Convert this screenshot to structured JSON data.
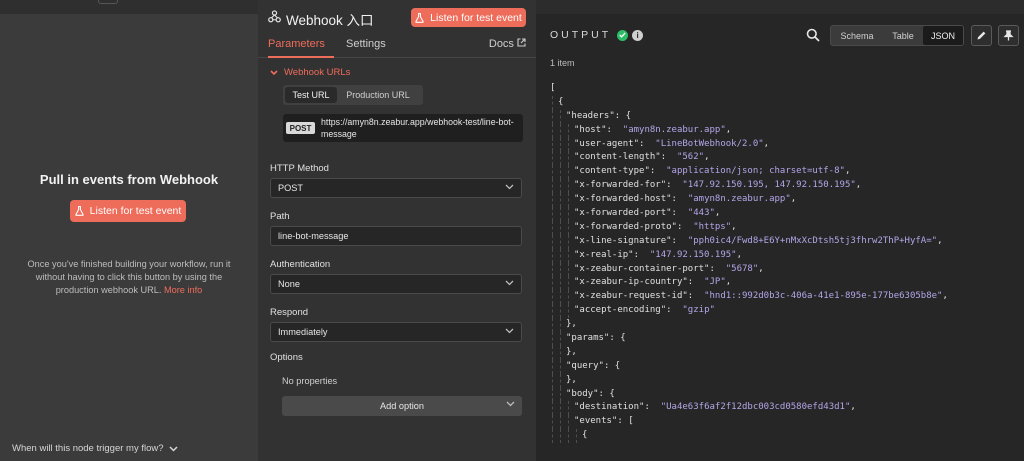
{
  "left_panel": {
    "title": "Pull in events from Webhook",
    "listen_button": "Listen for test event",
    "description": "Once you've finished building your workflow, run it without having to click this button by using the production webhook URL.",
    "more_info": "More info",
    "footer": "When will this node trigger my flow?"
  },
  "node": {
    "title": "Webhook 入口",
    "listen_button": "Listen for test event",
    "tabs": [
      "Parameters",
      "Settings"
    ],
    "docs": "Docs",
    "section": "Webhook URLs",
    "url_tabs": [
      "Test URL",
      "Production URL"
    ],
    "method_tag": "POST",
    "url": "https://amyn8n.zeabur.app/webhook-test/line-bot-message",
    "fields": {
      "http_method_label": "HTTP Method",
      "http_method_value": "POST",
      "path_label": "Path",
      "path_value": "line-bot-message",
      "auth_label": "Authentication",
      "auth_value": "None",
      "respond_label": "Respond",
      "respond_value": "Immediately",
      "options_label": "Options",
      "no_properties": "No properties",
      "add_option": "Add option"
    }
  },
  "output": {
    "title": "OUTPUT",
    "views": [
      "Schema",
      "Table",
      "JSON"
    ],
    "active_view": "JSON",
    "item_count": "1 item",
    "json_lines": [
      {
        "d": 0,
        "t": [
          [
            "p",
            "["
          ]
        ]
      },
      {
        "d": 1,
        "t": [
          [
            "p",
            "{"
          ]
        ]
      },
      {
        "d": 2,
        "t": [
          [
            "k",
            "\"headers\""
          ],
          [
            "p",
            ": {"
          ]
        ]
      },
      {
        "d": 3,
        "t": [
          [
            "k",
            "\"host\""
          ],
          [
            "p",
            ":  "
          ],
          [
            "s",
            "\"amyn8n.zeabur.app\""
          ],
          [
            "p",
            ","
          ]
        ]
      },
      {
        "d": 3,
        "t": [
          [
            "k",
            "\"user-agent\""
          ],
          [
            "p",
            ":  "
          ],
          [
            "s",
            "\"LineBotWebhook/2.0\""
          ],
          [
            "p",
            ","
          ]
        ]
      },
      {
        "d": 3,
        "t": [
          [
            "k",
            "\"content-length\""
          ],
          [
            "p",
            ":  "
          ],
          [
            "s",
            "\"562\""
          ],
          [
            "p",
            ","
          ]
        ]
      },
      {
        "d": 3,
        "t": [
          [
            "k",
            "\"content-type\""
          ],
          [
            "p",
            ":  "
          ],
          [
            "s",
            "\"application/json; charset=utf-8\""
          ],
          [
            "p",
            ","
          ]
        ]
      },
      {
        "d": 3,
        "t": [
          [
            "k",
            "\"x-forwarded-for\""
          ],
          [
            "p",
            ":  "
          ],
          [
            "s",
            "\"147.92.150.195, 147.92.150.195\""
          ],
          [
            "p",
            ","
          ]
        ]
      },
      {
        "d": 3,
        "t": [
          [
            "k",
            "\"x-forwarded-host\""
          ],
          [
            "p",
            ":  "
          ],
          [
            "s",
            "\"amyn8n.zeabur.app\""
          ],
          [
            "p",
            ","
          ]
        ]
      },
      {
        "d": 3,
        "t": [
          [
            "k",
            "\"x-forwarded-port\""
          ],
          [
            "p",
            ":  "
          ],
          [
            "s",
            "\"443\""
          ],
          [
            "p",
            ","
          ]
        ]
      },
      {
        "d": 3,
        "t": [
          [
            "k",
            "\"x-forwarded-proto\""
          ],
          [
            "p",
            ":  "
          ],
          [
            "s",
            "\"https\""
          ],
          [
            "p",
            ","
          ]
        ]
      },
      {
        "d": 3,
        "t": [
          [
            "k",
            "\"x-line-signature\""
          ],
          [
            "p",
            ":  "
          ],
          [
            "s",
            "\"pph0ic4/Fwd8+E6Y+nMxXcDtsh5tj3fhrw2ThP+HyfA=\""
          ],
          [
            "p",
            ","
          ]
        ]
      },
      {
        "d": 3,
        "t": [
          [
            "k",
            "\"x-real-ip\""
          ],
          [
            "p",
            ":  "
          ],
          [
            "s",
            "\"147.92.150.195\""
          ],
          [
            "p",
            ","
          ]
        ]
      },
      {
        "d": 3,
        "t": [
          [
            "k",
            "\"x-zeabur-container-port\""
          ],
          [
            "p",
            ":  "
          ],
          [
            "s",
            "\"5678\""
          ],
          [
            "p",
            ","
          ]
        ]
      },
      {
        "d": 3,
        "t": [
          [
            "k",
            "\"x-zeabur-ip-country\""
          ],
          [
            "p",
            ":  "
          ],
          [
            "s",
            "\"JP\""
          ],
          [
            "p",
            ","
          ]
        ]
      },
      {
        "d": 3,
        "t": [
          [
            "k",
            "\"x-zeabur-request-id\""
          ],
          [
            "p",
            ":  "
          ],
          [
            "s",
            "\"hnd1::992d0b3c-406a-41e1-895e-177be6305b8e\""
          ],
          [
            "p",
            ","
          ]
        ]
      },
      {
        "d": 3,
        "t": [
          [
            "k",
            "\"accept-encoding\""
          ],
          [
            "p",
            ":  "
          ],
          [
            "s",
            "\"gzip\""
          ]
        ]
      },
      {
        "d": 2,
        "t": [
          [
            "p",
            "},"
          ]
        ]
      },
      {
        "d": 2,
        "t": [
          [
            "k",
            "\"params\""
          ],
          [
            "p",
            ": {"
          ]
        ]
      },
      {
        "d": 2,
        "t": [
          [
            "p",
            "},"
          ]
        ]
      },
      {
        "d": 2,
        "t": [
          [
            "k",
            "\"query\""
          ],
          [
            "p",
            ": {"
          ]
        ]
      },
      {
        "d": 2,
        "t": [
          [
            "p",
            "},"
          ]
        ]
      },
      {
        "d": 2,
        "t": [
          [
            "k",
            "\"body\""
          ],
          [
            "p",
            ": {"
          ]
        ]
      },
      {
        "d": 3,
        "t": [
          [
            "k",
            "\"destination\""
          ],
          [
            "p",
            ":  "
          ],
          [
            "s",
            "\"Ua4e63f6af2f12dbc003cd0580efd43d1\""
          ],
          [
            "p",
            ","
          ]
        ]
      },
      {
        "d": 3,
        "t": [
          [
            "k",
            "\"events\""
          ],
          [
            "p",
            ": ["
          ]
        ]
      },
      {
        "d": 4,
        "t": [
          [
            "p",
            "{"
          ]
        ]
      }
    ]
  },
  "colors": {
    "accent": "#ee6c5a",
    "success": "#2dbd67",
    "json_string": "#b4a6e8"
  },
  "icons": [
    "webhook-icon",
    "flask-icon",
    "chevron-down-icon",
    "external-link-icon",
    "check-circle-icon",
    "info-icon",
    "search-icon",
    "pencil-icon",
    "pin-icon"
  ]
}
